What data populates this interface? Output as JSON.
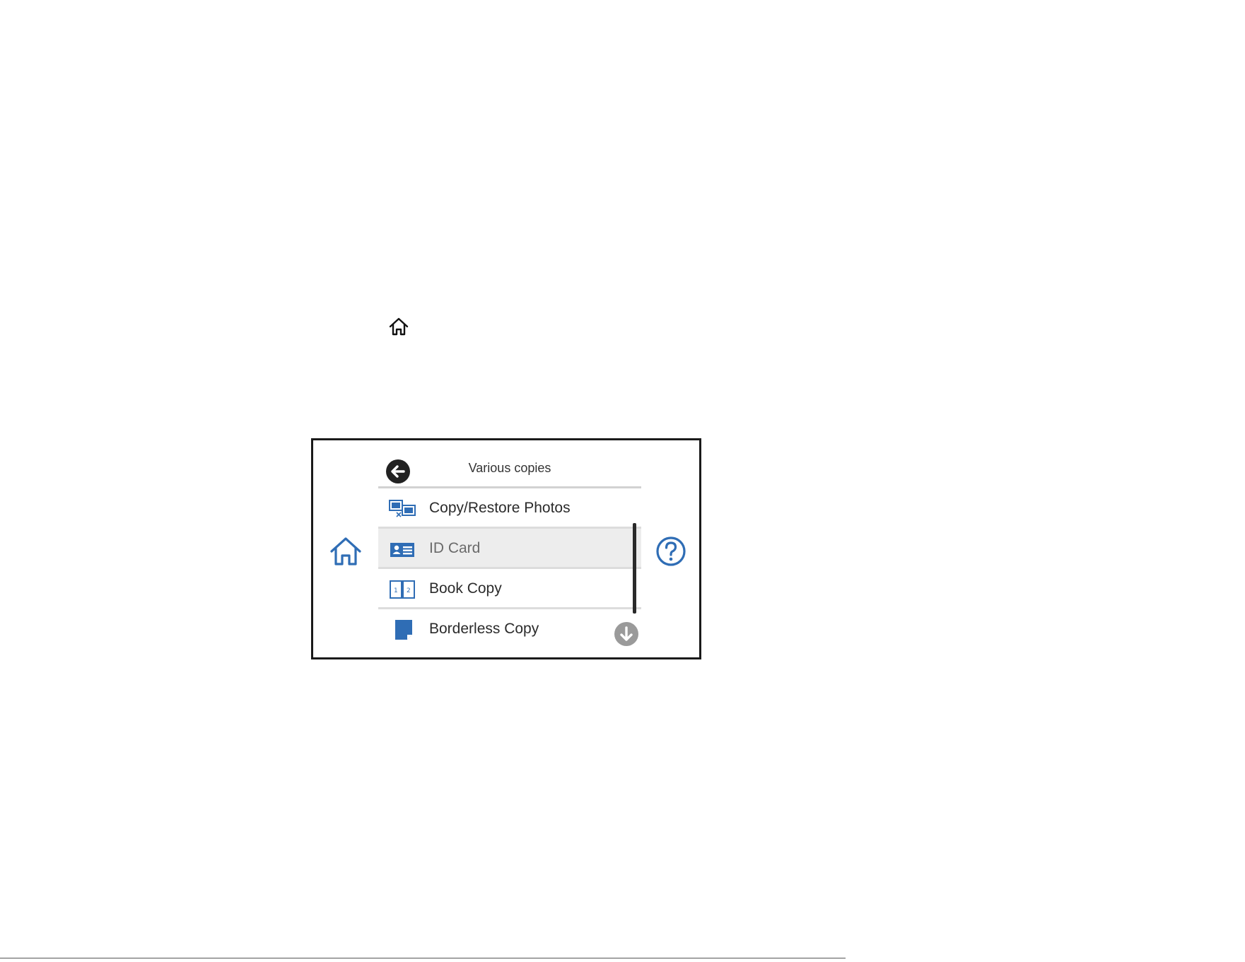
{
  "panel": {
    "header": {
      "title": "Various copies",
      "back_icon": "arrow-left-circle-icon"
    },
    "side_home_icon": "home-icon",
    "help_icon": "question-circle-icon",
    "menu": [
      {
        "label": "Copy/Restore Photos",
        "icon": "photos-icon",
        "selected": false
      },
      {
        "label": "ID Card",
        "icon": "id-card-icon",
        "selected": true
      },
      {
        "label": "Book Copy",
        "icon": "book-icon",
        "selected": false
      },
      {
        "label": "Borderless Copy",
        "icon": "borderless-page-icon",
        "selected": false
      }
    ],
    "scroll_down_icon": "arrow-down-circle-icon"
  },
  "colors": {
    "icon_blue": "#2f6db5",
    "selected_row": "#ededed",
    "divider": "#d2d2d2",
    "scroll_button": "#9a9a9a"
  }
}
